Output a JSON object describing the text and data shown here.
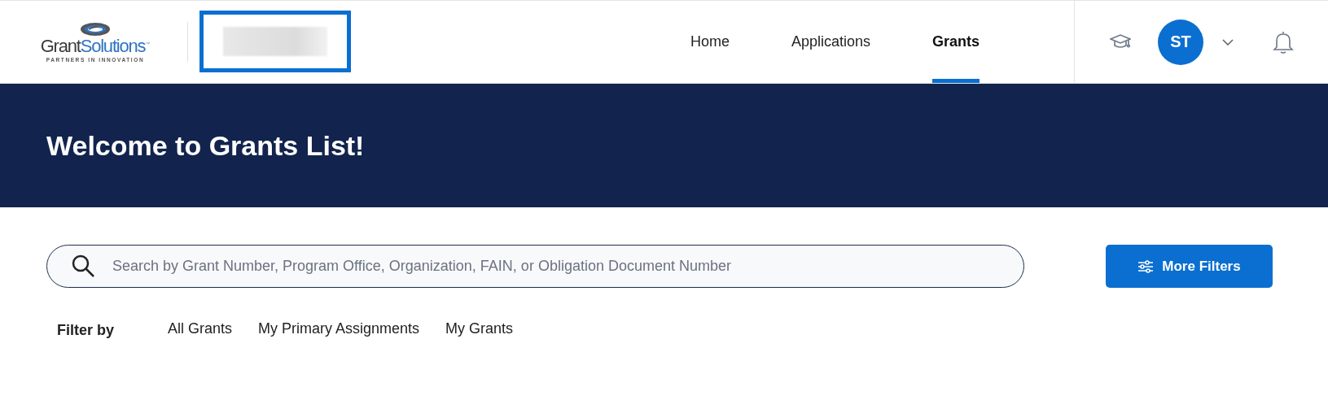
{
  "header": {
    "logo": {
      "word_1": "Grant",
      "word_2": "Solutions",
      "mark": "™",
      "tagline": "PARTNERS IN INNOVATION"
    },
    "nav": [
      {
        "label": "Home",
        "selected": false
      },
      {
        "label": "Applications",
        "selected": false
      },
      {
        "label": "Grants",
        "selected": true
      }
    ],
    "avatar": {
      "initials": "ST"
    }
  },
  "banner": {
    "title": "Welcome to Grants List!"
  },
  "search": {
    "placeholder": "Search by Grant Number, Program Office, Organization, FAIN, or Obligation Document Number"
  },
  "more_filters_button": "More Filters",
  "filter": {
    "label": "Filter by",
    "options": [
      {
        "label": "All Grants",
        "selected": false
      },
      {
        "label": "My Primary Assignments",
        "selected": false
      },
      {
        "label": "My Grants",
        "selected": false
      }
    ]
  }
}
